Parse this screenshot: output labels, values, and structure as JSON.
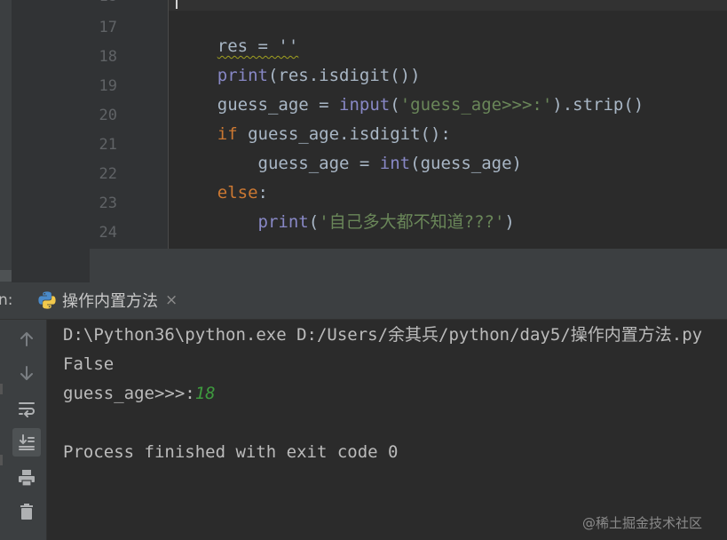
{
  "editor": {
    "lines": [
      {
        "num": "18",
        "segments": []
      },
      {
        "num": "17",
        "segments": [
          {
            "text": "res = ''",
            "cls": "squig"
          }
        ]
      },
      {
        "num": "18",
        "segments": [
          {
            "text": "print",
            "cls": "bi"
          },
          {
            "text": "(res.isdigit())",
            "cls": ""
          }
        ]
      },
      {
        "num": "19",
        "segments": [
          {
            "text": "guess_age = ",
            "cls": ""
          },
          {
            "text": "input",
            "cls": "bi"
          },
          {
            "text": "(",
            "cls": ""
          },
          {
            "text": "'guess_age>>>:'",
            "cls": "str"
          },
          {
            "text": ").strip()",
            "cls": ""
          }
        ]
      },
      {
        "num": "20",
        "segments": [
          {
            "text": "if ",
            "cls": "kw"
          },
          {
            "text": "guess_age.isdigit():",
            "cls": ""
          }
        ]
      },
      {
        "num": "21",
        "segments": [
          {
            "text": "    guess_age = ",
            "cls": ""
          },
          {
            "text": "int",
            "cls": "bi"
          },
          {
            "text": "(guess_age)",
            "cls": ""
          }
        ]
      },
      {
        "num": "22",
        "segments": [
          {
            "text": "else",
            "cls": "kw"
          },
          {
            "text": ":",
            "cls": ""
          }
        ]
      },
      {
        "num": "23",
        "segments": [
          {
            "text": "    ",
            "cls": ""
          },
          {
            "text": "print",
            "cls": "bi"
          },
          {
            "text": "(",
            "cls": ""
          },
          {
            "text": "'自己多大都不知道???'",
            "cls": "str"
          },
          {
            "text": ")",
            "cls": ""
          }
        ]
      },
      {
        "num": "24",
        "segments": []
      }
    ]
  },
  "run": {
    "label": "n:",
    "tab": {
      "title": "操作内置方法",
      "close": "×",
      "icon": "python-icon"
    }
  },
  "toolbar": {
    "buttons": [
      "arrow-up-icon",
      "arrow-down-icon",
      "soft-wrap-icon",
      "scroll-to-end-icon",
      "print-icon",
      "trash-icon"
    ]
  },
  "console": {
    "cmd": "D:\\Python36\\python.exe D:/Users/余其兵/python/day5/操作内置方法.py",
    "output1": "False",
    "prompt": "guess_age>>>:",
    "input_value": "18",
    "exit_msg": "Process finished with exit code 0"
  },
  "watermark": "@稀土掘金技术社区",
  "colors": {
    "keyword": "#cc7832",
    "builtin": "#8888c6",
    "string": "#6a8759",
    "input": "#3e9b3e"
  }
}
